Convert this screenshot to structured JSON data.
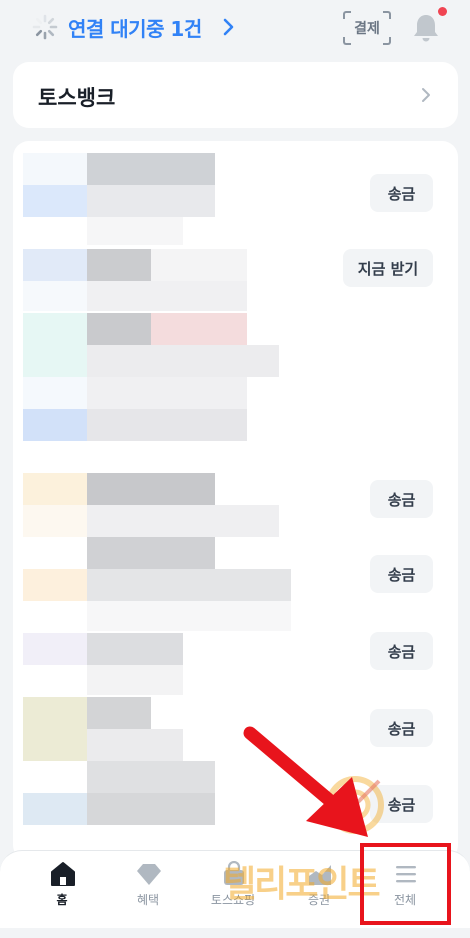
{
  "topbar": {
    "connection_label": "연결 대기중 1건",
    "pay_label": "결제"
  },
  "bank": {
    "title": "토스뱅크"
  },
  "list": {
    "buttons": [
      {
        "id": "b1",
        "label": "송금"
      },
      {
        "id": "b2",
        "label": "지금 받기"
      },
      {
        "id": "b3",
        "label": "송금"
      },
      {
        "id": "b4",
        "label": "송금"
      },
      {
        "id": "b5",
        "label": "송금"
      },
      {
        "id": "b6",
        "label": "송금"
      },
      {
        "id": "b7",
        "label": "송금"
      }
    ]
  },
  "bottom_nav": {
    "items": [
      {
        "label": "홈",
        "icon": "home-icon",
        "active": true
      },
      {
        "label": "혜택",
        "icon": "diamond-icon",
        "active": false
      },
      {
        "label": "토스쇼핑",
        "icon": "shopping-bag-icon",
        "active": false
      },
      {
        "label": "증권",
        "icon": "stock-chart-icon",
        "active": false
      },
      {
        "label": "전체",
        "icon": "menu-icon",
        "active": false
      }
    ]
  },
  "watermark": {
    "text": "텔리포인트"
  },
  "colors": {
    "accent": "#3182f6",
    "highlight": "#e8141c",
    "notification_dot": "#f04452",
    "background": "#f2f4f6"
  }
}
